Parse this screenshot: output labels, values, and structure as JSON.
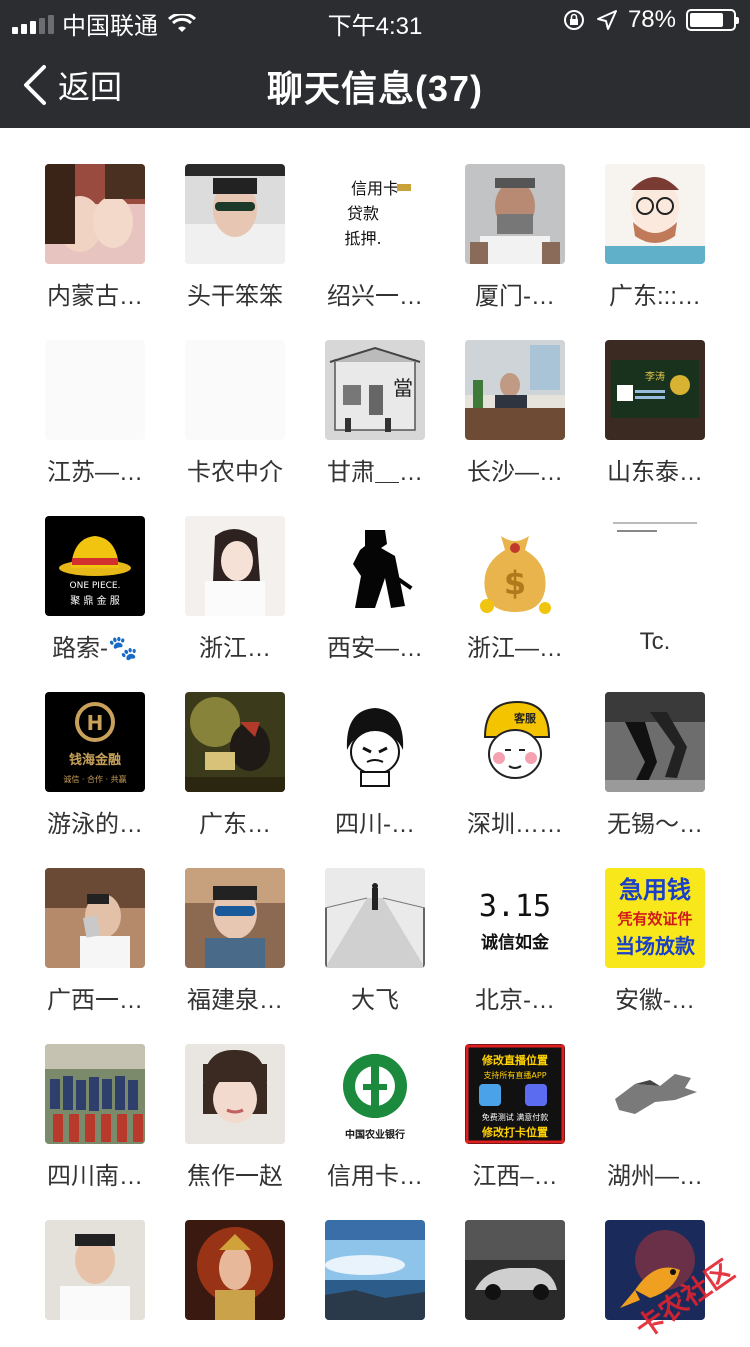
{
  "status": {
    "carrier": "中国联通",
    "time": "下午4:31",
    "battery_text": "78%",
    "battery_level": 0.78
  },
  "nav": {
    "back_label": "返回",
    "title": "聊天信息(37)"
  },
  "members": [
    {
      "name": "内蒙古…",
      "avatar": "couple-photo"
    },
    {
      "name": "头干笨笨",
      "avatar": "young-man-sunglasses"
    },
    {
      "name": "绍兴一…",
      "avatar": "text-card",
      "avatar_text": [
        "信用卡",
        "贷款",
        "抵押."
      ]
    },
    {
      "name": "厦门-…",
      "avatar": "bearded-man"
    },
    {
      "name": "广东:::…",
      "avatar": "cartoon-hipster"
    },
    {
      "name": "江苏—…",
      "avatar": "blank"
    },
    {
      "name": "卡农中介",
      "avatar": "blank"
    },
    {
      "name": "甘肃＿…",
      "avatar": "sketch-building",
      "avatar_text": [
        "當"
      ]
    },
    {
      "name": "长沙—…",
      "avatar": "office-man"
    },
    {
      "name": "山东泰…",
      "avatar": "business-card",
      "avatar_text": [
        "李涛"
      ]
    },
    {
      "name": "路索-🐾",
      "avatar": "one-piece-hat",
      "avatar_text": [
        "ONE PIECE.",
        "聚 鼎 金 服"
      ]
    },
    {
      "name": "浙江…",
      "avatar": "girl-photo"
    },
    {
      "name": "西安—…",
      "avatar": "soldier-silhouette"
    },
    {
      "name": "浙江—…",
      "avatar": "money-bag"
    },
    {
      "name": "Tc.",
      "avatar": "document-page"
    },
    {
      "name": "游泳的…",
      "avatar": "gold-logo",
      "avatar_text": [
        "钱海金融",
        "诚信 · 合作 · 共赢"
      ]
    },
    {
      "name": "广东…",
      "avatar": "fantasy-art"
    },
    {
      "name": "四川-…",
      "avatar": "meme-face"
    },
    {
      "name": "深圳……",
      "avatar": "helmet-meme",
      "avatar_text": [
        "客服"
      ]
    },
    {
      "name": "无锡～…",
      "avatar": "bw-legs"
    },
    {
      "name": "广西一…",
      "avatar": "selfie-man"
    },
    {
      "name": "福建泉…",
      "avatar": "man-sunglasses"
    },
    {
      "name": "大飞",
      "avatar": "bridge-walker"
    },
    {
      "name": "北京-…",
      "avatar": "text-card-315",
      "avatar_text": [
        "3.15",
        "诚信如金"
      ]
    },
    {
      "name": "安徽-…",
      "avatar": "yellow-ad",
      "avatar_text": [
        "急用钱",
        "凭有效证件",
        "当场放款"
      ]
    },
    {
      "name": "四川南…",
      "avatar": "group-photo"
    },
    {
      "name": "焦作一赵",
      "avatar": "child-photo"
    },
    {
      "name": "信用卡…",
      "avatar": "bank-logo",
      "avatar_text": [
        "中国农业银行"
      ]
    },
    {
      "name": "江西–…",
      "avatar": "red-ad",
      "avatar_text": [
        "修改直播位置",
        "支持所有直播APP",
        "免费测试 满意付款",
        "修改打卡位置"
      ]
    },
    {
      "name": "湖州—…",
      "avatar": "horse-logo"
    },
    {
      "name": "",
      "avatar": "man-white-shirt"
    },
    {
      "name": "",
      "avatar": "warrior-art"
    },
    {
      "name": "",
      "avatar": "seascape"
    },
    {
      "name": "",
      "avatar": "car-photo"
    },
    {
      "name": "",
      "avatar": "koi-fish"
    }
  ],
  "watermark_text": "卡农社区",
  "colors": {
    "nav_bg": "#2b2d30",
    "page_bg": "#ffffff",
    "name_text": "#333333"
  }
}
